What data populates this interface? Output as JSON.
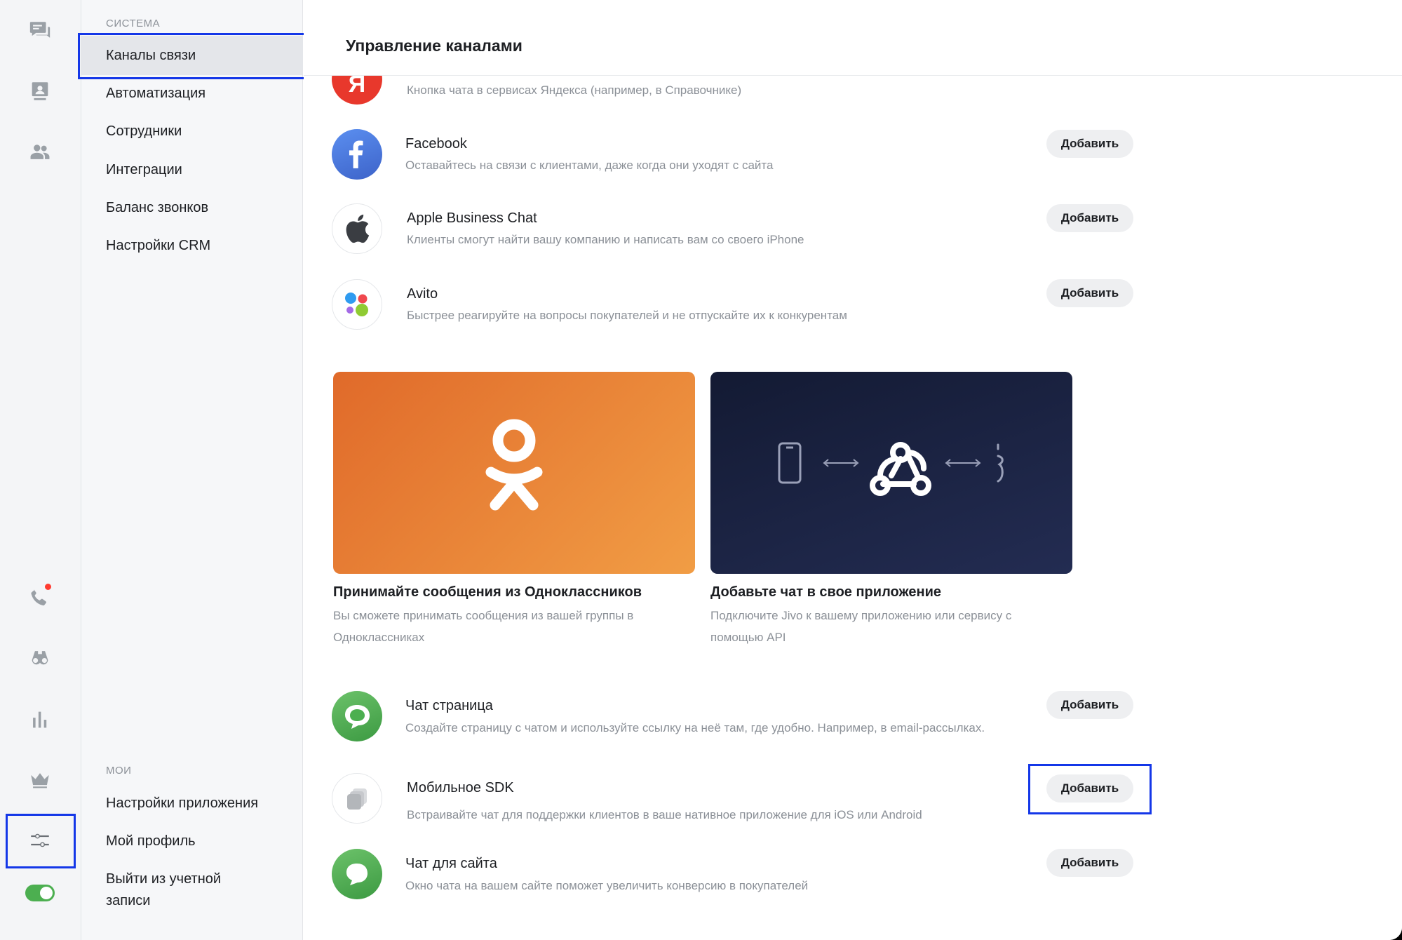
{
  "rail": {
    "icons": [
      "chats-icon",
      "contacts-icon",
      "team-icon",
      "phone-icon",
      "binoculars-icon",
      "stats-icon",
      "crown-icon",
      "settings-sliders-icon"
    ],
    "status_toggle_on": true
  },
  "sidebar": {
    "section_system": "СИСТЕМА",
    "system_items": [
      {
        "label": "Каналы связи",
        "active": true
      },
      {
        "label": "Автоматизация"
      },
      {
        "label": "Сотрудники"
      },
      {
        "label": "Интеграции"
      },
      {
        "label": "Баланс звонков"
      },
      {
        "label": "Настройки CRM"
      }
    ],
    "section_mine": "МОИ",
    "mine_items": [
      {
        "label": "Настройки приложения"
      },
      {
        "label": "Мой профиль"
      },
      {
        "label": "Выйти из учетной записи"
      }
    ]
  },
  "main": {
    "title": "Управление каналами",
    "channels_top": [
      {
        "name": "",
        "desc": "Кнопка чата в сервисах Яндекса (например, в Справочнике)",
        "icon": "yandex-icon"
      },
      {
        "name": "Facebook",
        "desc": "Оставайтесь на связи с клиентами, даже когда они уходят с сайта",
        "icon": "facebook-icon",
        "button": "Добавить"
      },
      {
        "name": "Apple Business Chat",
        "desc": "Клиенты смогут найти вашу компанию и написать вам со своего iPhone",
        "icon": "apple-icon",
        "button": "Добавить"
      },
      {
        "name": "Avito",
        "desc": "Быстрее реагируйте на вопросы покупателей и не отпускайте их к конкурентам",
        "icon": "avito-icon",
        "button": "Добавить"
      }
    ],
    "cards": [
      {
        "title": "Принимайте сообщения из Одноклассников",
        "desc": "Вы сможете принимать сообщения из вашей группы в Одноклассниках",
        "icon": "odnoklassniki-icon"
      },
      {
        "title": "Добавьте чат в свое приложение",
        "desc": "Подключите Jivo к вашему приложению или сервису с помощью API",
        "icon": "webhook-icon"
      }
    ],
    "channels_bottom": [
      {
        "name": "Чат страница",
        "desc": "Создайте страницу с чатом и используйте ссылку на неё там, где удобно. Например, в email-рассылках.",
        "icon": "chat-page-icon",
        "button": "Добавить"
      },
      {
        "name": "Мобильное SDK",
        "desc": "Встраивайте чат для поддержки клиентов в ваше нативное приложение для iOS или Android",
        "icon": "mobile-sdk-icon",
        "button": "Добавить"
      },
      {
        "name": "Чат для сайта",
        "desc": "Окно чата на вашем сайте поможет увеличить конверсию в покупателей",
        "icon": "site-chat-icon",
        "button": "Добавить"
      }
    ]
  },
  "colors": {
    "highlight": "#1437e8",
    "toggle": "#4caf50",
    "notification_dot": "#ff3b30"
  }
}
